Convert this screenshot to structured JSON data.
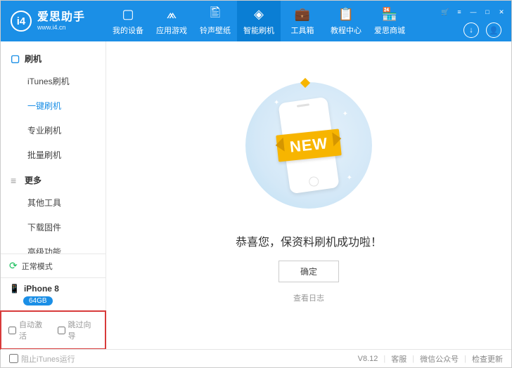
{
  "app": {
    "title": "爱思助手",
    "url": "www.i4.cn",
    "logo_glyph": "i4"
  },
  "nav": [
    {
      "label": "我的设备",
      "icon": "▢"
    },
    {
      "label": "应用游戏",
      "icon": "⩕"
    },
    {
      "label": "铃声壁纸",
      "icon": "🖺"
    },
    {
      "label": "智能刷机",
      "icon": "◈",
      "active": true
    },
    {
      "label": "工具箱",
      "icon": "💼"
    },
    {
      "label": "教程中心",
      "icon": "📋"
    },
    {
      "label": "爱思商城",
      "icon": "🏪"
    }
  ],
  "window_controls": {
    "cart": "🛒",
    "menu": "≡",
    "min": "—",
    "max": "□",
    "close": "✕"
  },
  "header_icons": {
    "download": "↓",
    "user": "👤"
  },
  "sidebar": {
    "sections": [
      {
        "title": "刷机",
        "icon": "▢",
        "items": [
          "iTunes刷机",
          "一键刷机",
          "专业刷机",
          "批量刷机"
        ],
        "active_index": 1
      },
      {
        "title": "更多",
        "icon": "≡",
        "items": [
          "其他工具",
          "下载固件",
          "高级功能"
        ],
        "active_index": -1
      }
    ],
    "status": {
      "label": "正常模式"
    },
    "device": {
      "name": "iPhone 8",
      "storage": "64GB"
    },
    "options": {
      "auto_activate": "自动激活",
      "skip_guide": "跳过向导"
    }
  },
  "main": {
    "ribbon": "NEW",
    "message": "恭喜您，保资料刷机成功啦！",
    "ok_button": "确定",
    "view_log": "查看日志"
  },
  "footer": {
    "block_itunes": "阻止iTunes运行",
    "version": "V8.12",
    "support": "客服",
    "wechat": "微信公众号",
    "update": "检查更新"
  }
}
